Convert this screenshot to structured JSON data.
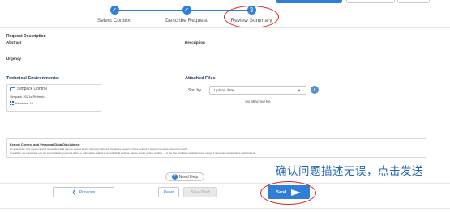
{
  "stepper": {
    "steps": [
      {
        "label": "Select Context",
        "status": "done",
        "icon": "check-icon"
      },
      {
        "label": "Describe Request",
        "status": "done",
        "icon": "check-icon"
      },
      {
        "label": "Review Summary",
        "status": "current",
        "number": "3"
      }
    ]
  },
  "request": {
    "title": "Request Description",
    "abstract_label": "Abstract",
    "description_label": "Description",
    "urgency_label": "Urgency"
  },
  "technical": {
    "title": "Technical Environments:",
    "product": "Simpack Control",
    "release": "Simpack 2021x Refresh1",
    "os": "Windows 10"
  },
  "attached": {
    "title": "Attached Files:",
    "sort_label": "Sort by",
    "sort_value": "Upload date",
    "empty_text": "No attached file"
  },
  "disclaimer": {
    "title": "Export Control and Personal Data Disclaimer:",
    "line1": "As a reminder, this request and its associated data may be viewed and/or stored by Dassault Systèmes support entities located in several countries around the world.",
    "line2": "In addition, we encourage you not to provide any personal data (i.e. information related to an individual such as: names, email, phone number,...) in the free text fields or attachments except if necessary to reproduce your incident"
  },
  "annotation": "确认问题描述无误，点击发送",
  "help": {
    "label": "Need Help"
  },
  "actions": {
    "previous": "Previous",
    "reset": "Reset",
    "save_draft": "Save Draft",
    "send": "Send"
  },
  "colors": {
    "accent": "#2f7ed8",
    "highlight": "#e02020",
    "annotation": "#2166b3"
  }
}
